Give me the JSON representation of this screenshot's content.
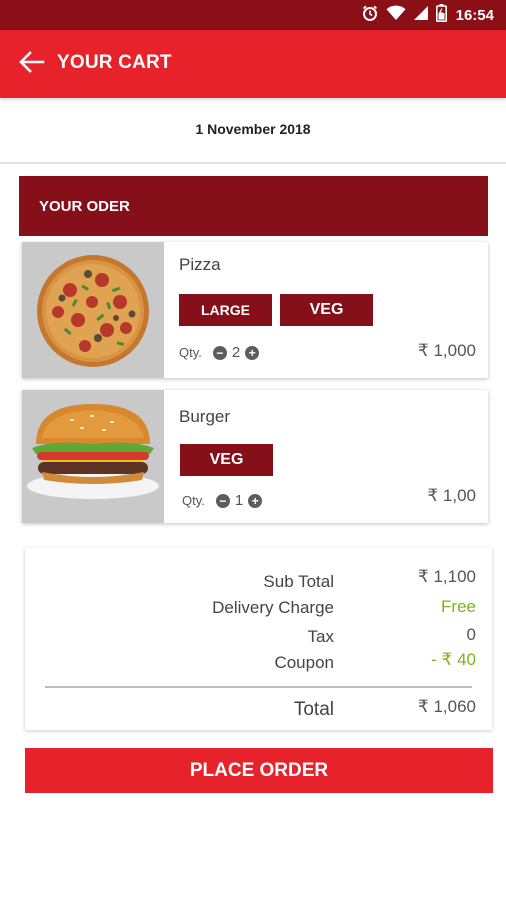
{
  "status_bar": {
    "time": "16:54",
    "icons": [
      "alarm-icon",
      "wifi-icon",
      "signal-icon",
      "battery-icon"
    ]
  },
  "header": {
    "title": "YOUR CART",
    "back_icon": "arrow-left-icon"
  },
  "date": "1 November 2018",
  "order": {
    "heading": "YOUR ODER",
    "items": [
      {
        "name": "Pizza",
        "tags": [
          "LARGE",
          "VEG"
        ],
        "qty_label": "Qty.",
        "qty": "2",
        "price": "₹ 1,000",
        "image": "pizza-image"
      },
      {
        "name": "Burger",
        "tags": [
          "VEG"
        ],
        "qty_label": "Qty.",
        "qty": "1",
        "price": "₹ 1,00",
        "image": "burger-image"
      }
    ]
  },
  "summary": {
    "subtotal_label": "Sub Total",
    "subtotal": "₹ 1,100",
    "delivery_label": "Delivery Charge",
    "delivery": "Free",
    "tax_label": "Tax",
    "tax": "0",
    "coupon_label": "Coupon",
    "coupon": "- ₹ 40",
    "total_label": "Total",
    "total": "₹ 1,060"
  },
  "place_order_label": "PLACE ORDER",
  "colors": {
    "primary_red": "#e8222a",
    "dark_red": "#86101a",
    "accent_green": "#7cb320"
  }
}
